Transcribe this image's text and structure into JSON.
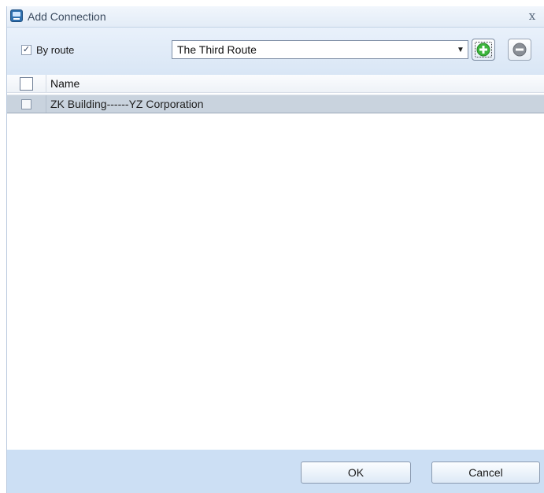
{
  "window": {
    "title": "Add Connection",
    "close_glyph": "x",
    "app_icon": "connection-app-icon"
  },
  "toolbar": {
    "by_route_label": "By route",
    "by_route_checked": true,
    "route_select_value": "The Third Route",
    "add_icon": "plus-circle-icon",
    "remove_icon": "minus-circle-icon"
  },
  "grid": {
    "header_name": "Name",
    "rows": [
      {
        "name": "ZK Building------YZ Corporation",
        "checked": false
      }
    ]
  },
  "footer": {
    "ok_label": "OK",
    "cancel_label": "Cancel"
  },
  "colors": {
    "toolbar_bg": "#d9e6f5",
    "footer_bg": "#ccdff4",
    "selected_row_bg": "#c9d3de",
    "add_icon_green": "#3cb53c",
    "remove_icon_gray": "#8a8f96"
  }
}
